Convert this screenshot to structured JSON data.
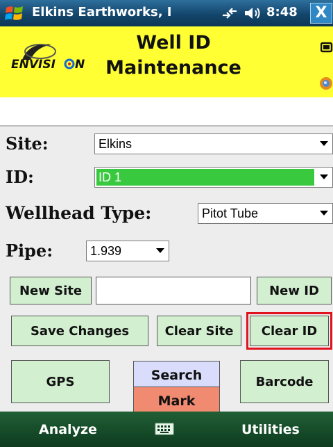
{
  "status_bar": {
    "app_title": "Elkins Earthworks, I",
    "time": "8:48",
    "close_label": "X",
    "icons": [
      "windows-start-icon",
      "connectivity-icon",
      "volume-icon"
    ]
  },
  "header": {
    "logo_text": "ENVISION",
    "title_line1": "Well ID",
    "title_line2": "Maintenance",
    "icons": [
      "battery-icon",
      "globe-icon"
    ],
    "background": "#ffff33"
  },
  "form": {
    "site": {
      "label": "Site:",
      "value": "Elkins"
    },
    "id": {
      "label": "ID:",
      "value": "ID 1",
      "highlight": "#38c93e"
    },
    "wellhead_type": {
      "label": "Wellhead Type:",
      "value": "Pitot Tube"
    },
    "pipe": {
      "label": "Pipe:",
      "value": "1.939"
    },
    "new_site_button": "New Site",
    "new_site_input": "",
    "new_id_button": "New ID",
    "save_changes_button": "Save Changes",
    "clear_site_button": "Clear Site",
    "clear_id_button": "Clear ID",
    "gps_button": "GPS",
    "search_button": "Search",
    "mark_button": "Mark",
    "barcode_button": "Barcode",
    "button_color": "#d2efd0",
    "focus_color": "#e0141e"
  },
  "bottom_bar": {
    "left_soft_key": "Analyze",
    "right_soft_key": "Utilities",
    "center_icon": "keyboard-icon"
  }
}
